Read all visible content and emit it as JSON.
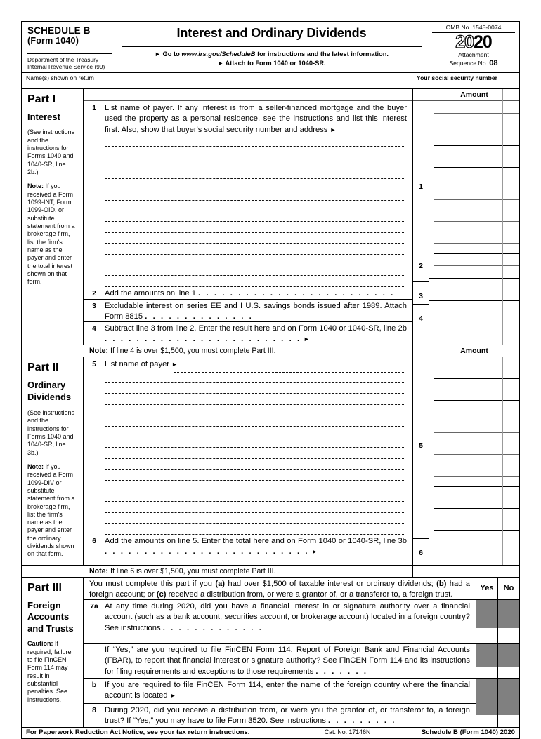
{
  "header": {
    "schedule": "SCHEDULE B",
    "form_ref": "(Form 1040)",
    "department": "Department of the Treasury",
    "service": "Internal Revenue Service (99)",
    "title": "Interest and Ordinary Dividends",
    "goto_prefix": "Go to",
    "goto_url": "www.irs.gov/ScheduleB",
    "goto_suffix": "for instructions and the latest information.",
    "attach_line": "Attach to Form 1040 or 1040-SR.",
    "omb": "OMB No. 1545-0074",
    "year_light": "20",
    "year_bold": "20",
    "attachment_label": "Attachment",
    "sequence_label": "Sequence No.",
    "sequence_no": "08"
  },
  "name_row": {
    "name_label": "Name(s) shown on return",
    "ssn_label": "Your social security number",
    "name_value": "",
    "ssn_value": ""
  },
  "part1": {
    "part_label": "Part I",
    "part_title": "Interest",
    "see_instructions": "(See instructions and the instructions for Forms 1040 and 1040-SR, line 2b.)",
    "note_bold": "Note:",
    "note_text": "If you received a Form 1099-INT, Form 1099-OID, or substitute statement from a brokerage firm, list the firm's name as the payer and enter the total interest shown on that form.",
    "amount_header": "Amount",
    "line1_no": "1",
    "line1_text": "List name of payer. If any interest is from a seller-financed mortgage and the buyer used the property as a personal residence, see the instructions and list this interest first. Also, show that buyer's social security number and address",
    "line1_amt_no": "1",
    "dot_rows": 14,
    "line2_no": "2",
    "line2_text": "Add the amounts on line 1",
    "line2_amt_no": "2",
    "line3_no": "3",
    "line3_text": "Excludable interest on series EE and I U.S. savings bonds issued after 1989. Attach Form 8815",
    "line3_amt_no": "3",
    "line4_no": "4",
    "line4_text": "Subtract line 3 from line 2. Enter the result here and on Form 1040 or 1040-SR, line 2b",
    "line4_amt_no": "4",
    "note_bar_bold": "Note:",
    "note_bar_text": "If line 4 is over $1,500, you must complete Part III.",
    "note_bar_amount": "Amount"
  },
  "part2": {
    "part_label": "Part II",
    "part_title_1": "Ordinary",
    "part_title_2": "Dividends",
    "see_instructions": "(See instructions and the instructions for Forms 1040 and 1040-SR, line 3b.)",
    "note_bold": "Note:",
    "note_text": "If you received a Form 1099-DIV or substitute statement from a brokerage firm, list the firm's name as the payer and enter the ordinary dividends shown on that form.",
    "line5_no": "5",
    "line5_text": "List name of payer",
    "line5_amt_no": "5",
    "dot_rows": 16,
    "line6_no": "6",
    "line6_text": "Add the amounts on line 5. Enter the total here and on Form 1040 or 1040-SR, line 3b",
    "line6_amt_no": "6",
    "note_bar_bold": "Note:",
    "note_bar_text": "If line 6 is over $1,500, you must complete Part III."
  },
  "part3": {
    "part_label": "Part III",
    "part_title_1": "Foreign",
    "part_title_2": "Accounts",
    "part_title_3": "and Trusts",
    "caution_bold": "Caution:",
    "caution_text": "If required, failure to file FinCEN Form 114 may result in substantial penalties. See instructions.",
    "intro": "You must complete this part if you (a) had over $1,500 of taxable interest or ordinary dividends; (b) had a foreign account; or (c) received a distribution from, or were a grantor of, or a transferor to, a foreign trust.",
    "yes_label": "Yes",
    "no_label": "No",
    "line7a_no": "7a",
    "line7a_text": "At any time during 2020, did you have a financial interest in or signature authority over a financial account (such as a bank account, securities account, or brokerage account) located in a foreign country? See instructions",
    "line7a_cont_text": "If “Yes,” are you required to file FinCEN Form 114, Report of Foreign Bank and Financial Accounts (FBAR), to report that financial interest or signature authority? See FinCEN Form 114 and its instructions for filing requirements and exceptions to those requirements",
    "line7b_no": "b",
    "line7b_text": "If you are required to file FinCEN Form 114, enter the name of the foreign country where the financial account is located",
    "line7b_value": "",
    "line8_no": "8",
    "line8_text": "During 2020, did you receive a distribution from, or were you the grantor of, or transferor to, a foreign trust? If “Yes,” you may have to file Form 3520. See instructions"
  },
  "footer": {
    "paperwork": "For Paperwork Reduction Act Notice, see your tax return instructions.",
    "cat_no": "Cat. No. 17146N",
    "form_id": "Schedule B (Form 1040) 2020"
  },
  "colors": {
    "shade_gray": "#808080",
    "ink": "#000000",
    "paper": "#ffffff"
  }
}
